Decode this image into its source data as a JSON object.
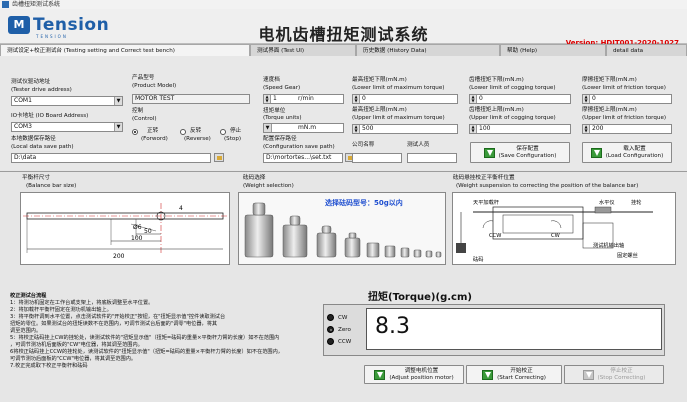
{
  "window": {
    "title": "齿槽扭矩测试系统"
  },
  "header": {
    "logo_mark": "M",
    "logo_text": "Tension",
    "logo_sub": "TENSION",
    "app_title": "电机齿槽扭矩测试系统",
    "version": "Version: HDJT001-2020-1027"
  },
  "tabs": [
    {
      "label": "测试设定+校正测试台 (Testing setting and Correct test bench)"
    },
    {
      "label": "测试界面 (Test UI)"
    },
    {
      "label": "历史数据 (History Data)"
    },
    {
      "label": "帮助 (Help)"
    },
    {
      "label": "detail data"
    }
  ],
  "settings": {
    "tester_drive_label": "测试仪驱动地址",
    "tester_drive_label_en": "(Tester drive address)",
    "tester_drive_value": "COM1",
    "io_board_label": "IO卡地址 (IO Board Address)",
    "io_board_value": "COM3",
    "local_save_label": "本地数据保存路径",
    "local_save_label_en": "(Local data save path)",
    "local_save_value": "D:\\data",
    "product_model_label": "产品型号",
    "product_model_label_en": "(Product Model)",
    "product_model_value": "MOTOR TEST",
    "control_label": "控制",
    "control_label_en": "(Control)",
    "control_options": [
      {
        "label": "正转",
        "label_en": "(Forword)",
        "selected": true
      },
      {
        "label": "反转",
        "label_en": "(Reverse)",
        "selected": false
      },
      {
        "label": "停止",
        "label_en": "(Stop)",
        "selected": false
      }
    ],
    "speed_label": "速度档",
    "speed_label_en": "(Speed Gear)",
    "speed_value": "1",
    "speed_unit": "r/min",
    "torque_units_label": "扭矩单位",
    "torque_units_label_en": "(Torque units)",
    "torque_units_value": "mN.m",
    "config_path_label": "配置保存路径",
    "config_path_label_en": "(Configuration save path)",
    "config_path_value": "D:\\mortortes...\\set.txt",
    "company_label": "公司名称",
    "tester_label": "测试人员",
    "max_torque_lower_label": "最高扭矩下限(mN.m)",
    "max_torque_lower_label_en": "(Lower limit of maximum torque)",
    "max_torque_lower_value": "0",
    "max_torque_upper_label": "最高扭矩上限(mN.m)",
    "max_torque_upper_label_en": "(Upper limit of maximum torque)",
    "max_torque_upper_value": "500",
    "cog_torque_lower_label": "齿槽扭矩下限(mN.m)",
    "cog_torque_lower_label_en": "(Lower limit of cogging torque)",
    "cog_torque_lower_value": "0",
    "cog_torque_upper_label": "齿槽扭矩上限(mN.m)",
    "cog_torque_upper_label_en": "(Upper limit of cogging torque)",
    "cog_torque_upper_value": "100",
    "friction_lower_label": "摩擦扭矩下限(mN.m)",
    "friction_lower_label_en": "(Lower limit of friction torque)",
    "friction_lower_value": "0",
    "friction_upper_label": "摩擦扭矩上限(mN.m)",
    "friction_upper_label_en": "(Upper limit of friction torque)",
    "friction_upper_value": "200",
    "save_config_label": "保存配置",
    "save_config_label_en": "(Save Configuration)",
    "load_config_label": "载入配置",
    "load_config_label_en": "(Load Configuration)"
  },
  "diagrams": {
    "balance_label": "平衡杆尺寸",
    "balance_label_en": "(Balance bar size)",
    "balance_dims": [
      "4",
      "Ø6",
      "50",
      "100",
      "200"
    ],
    "weight_label": "砝码选择",
    "weight_label_en": "(Weight selection)",
    "weight_caption": "选择砝码型号：50g以内",
    "suspension_label": "砝码悬挂校正平衡杆位置",
    "suspension_label_en": "(Weight suspension to correcting the position of the balance bar)",
    "suspension_notes": [
      "天平加载杆",
      "水平仪",
      "挂轮",
      "CCW",
      "CW",
      "测试机输出轴",
      "固定螺丝",
      "砝码"
    ]
  },
  "instructions": {
    "title": "校正测试台流程",
    "lines": [
      "1：将测功机固定在工作台或支架上，将底板调整至水平位置。",
      "2：将加载杆平衡杆固定在测功机输出轴上。",
      "3：将平衡杆调到水平位置，点击测试软件的\"开始校正\"按钮，在\"扭矩显示值\"控件读取测试台",
      "扭矩的零位。如果测试台的扭矩读数不在范围内，可调节测试台后面的\"调零\"电位器，将其",
      "调至范围内。",
      "5：将校正砝码挂上CW的挂轮处，读测试软件的\"扭矩显示值\"（扭矩=砝码的重量×平衡杆力臂的长度）如不在范围内",
      "，可调节测功机后面板的\"CW\"电位器，将其调至范围内。",
      "6将校正砝码挂上CCW的挂轮处，读测试软件的\"扭矩显示值\"（扭矩=砝码的重量×平衡杆力臂的长度）如不在范围内，",
      "可调节测功后面板的\"CCW\"电位器，将其调至范围内。",
      "7.校正完成取下校正平衡杆和砝码"
    ]
  },
  "torque": {
    "title": "扭矩(Torque)(g.cm)",
    "value": "8.3",
    "directions": [
      {
        "label": "CW",
        "active": false
      },
      {
        "label": "Zero",
        "active": true
      },
      {
        "label": "CCW",
        "active": false
      }
    ]
  },
  "actions": {
    "adjust_motor": "调整电机位置",
    "adjust_motor_en": "(Adjust position motor)",
    "start_correct": "开始校正",
    "start_correct_en": "(Start Correcting)",
    "stop_correct": "停止校正",
    "stop_correct_en": "(Stop Correcting)"
  },
  "colors": {
    "brand": "#1f5fa8",
    "version_text": "#dd0000",
    "weight_caption": "#1f4fd0"
  }
}
